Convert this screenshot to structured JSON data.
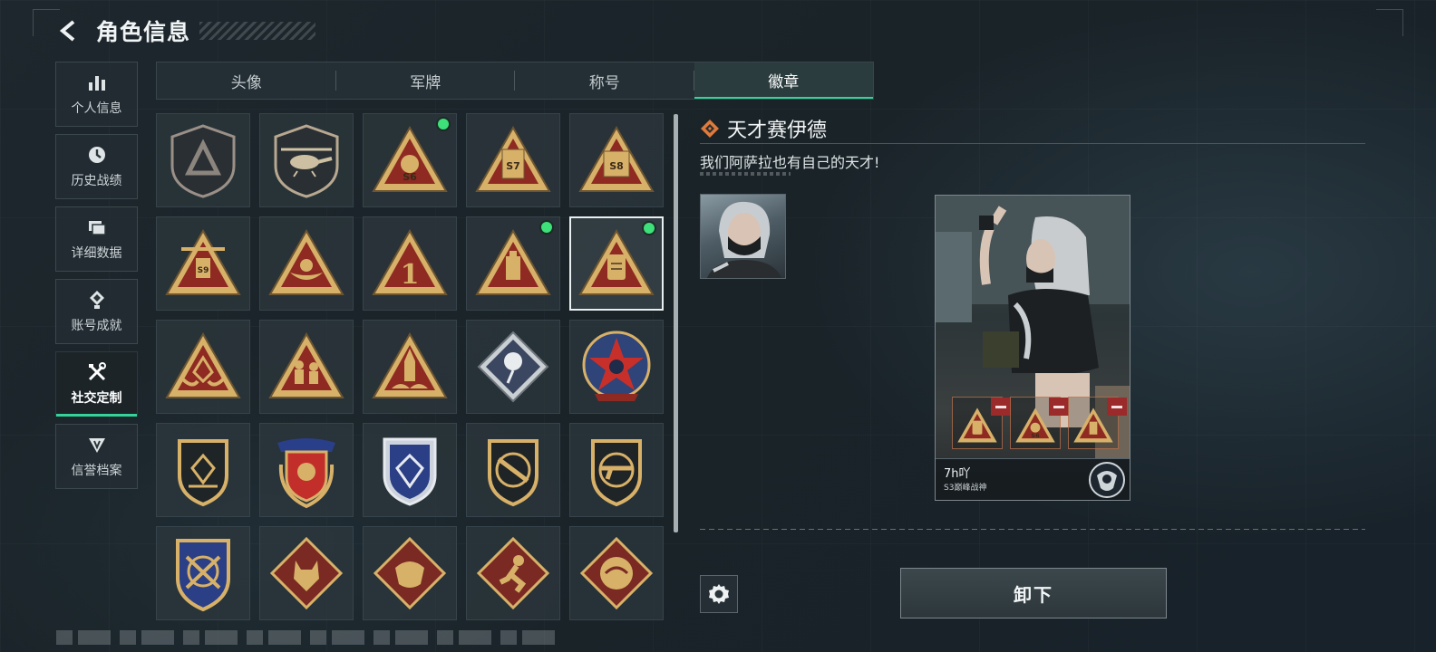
{
  "header": {
    "title": "角色信息"
  },
  "sidebar": {
    "items": [
      {
        "label": "个人信息",
        "icon": "bar-chart-icon"
      },
      {
        "label": "历史战绩",
        "icon": "history-clock-icon"
      },
      {
        "label": "详细数据",
        "icon": "folder-icon"
      },
      {
        "label": "账号成就",
        "icon": "achievement-icon"
      },
      {
        "label": "社交定制",
        "icon": "tools-icon",
        "active": true
      },
      {
        "label": "信誉档案",
        "icon": "reputation-icon"
      }
    ]
  },
  "tabs": [
    {
      "label": "头像"
    },
    {
      "label": "军牌"
    },
    {
      "label": "称号"
    },
    {
      "label": "徽章",
      "active": true
    }
  ],
  "badges": {
    "rows": 5,
    "columns": 5,
    "selected_index": 9,
    "new_indicator_indices": [
      2,
      8,
      9
    ],
    "text_marks": [
      "S6",
      "S7",
      "S8",
      "S9",
      "1"
    ]
  },
  "detail": {
    "title": "天才赛伊德",
    "description": "我们阿萨拉也有自己的天才!",
    "card": {
      "player_name": "7h吖",
      "rank": "S3巅峰战神",
      "slot_count": 3
    },
    "unequip_label": "卸下"
  },
  "colors": {
    "accent_green": "#34d399",
    "new_dot": "#3ee07a",
    "badge_gold": "#d8b169",
    "badge_red": "#8e2a22",
    "remove_red": "#9b2a2a",
    "orange_diamond": "#e07a3a"
  }
}
